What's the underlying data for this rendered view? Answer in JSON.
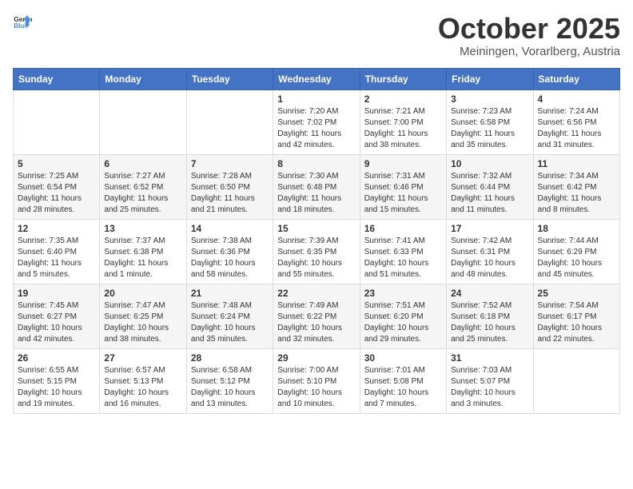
{
  "header": {
    "logo_general": "General",
    "logo_blue": "Blue",
    "title": "October 2025",
    "subtitle": "Meiningen, Vorarlberg, Austria"
  },
  "weekdays": [
    "Sunday",
    "Monday",
    "Tuesday",
    "Wednesday",
    "Thursday",
    "Friday",
    "Saturday"
  ],
  "weeks": [
    [
      {
        "day": "",
        "sunrise": "",
        "sunset": "",
        "daylight": ""
      },
      {
        "day": "",
        "sunrise": "",
        "sunset": "",
        "daylight": ""
      },
      {
        "day": "",
        "sunrise": "",
        "sunset": "",
        "daylight": ""
      },
      {
        "day": "1",
        "sunrise": "Sunrise: 7:20 AM",
        "sunset": "Sunset: 7:02 PM",
        "daylight": "Daylight: 11 hours and 42 minutes."
      },
      {
        "day": "2",
        "sunrise": "Sunrise: 7:21 AM",
        "sunset": "Sunset: 7:00 PM",
        "daylight": "Daylight: 11 hours and 38 minutes."
      },
      {
        "day": "3",
        "sunrise": "Sunrise: 7:23 AM",
        "sunset": "Sunset: 6:58 PM",
        "daylight": "Daylight: 11 hours and 35 minutes."
      },
      {
        "day": "4",
        "sunrise": "Sunrise: 7:24 AM",
        "sunset": "Sunset: 6:56 PM",
        "daylight": "Daylight: 11 hours and 31 minutes."
      }
    ],
    [
      {
        "day": "5",
        "sunrise": "Sunrise: 7:25 AM",
        "sunset": "Sunset: 6:54 PM",
        "daylight": "Daylight: 11 hours and 28 minutes."
      },
      {
        "day": "6",
        "sunrise": "Sunrise: 7:27 AM",
        "sunset": "Sunset: 6:52 PM",
        "daylight": "Daylight: 11 hours and 25 minutes."
      },
      {
        "day": "7",
        "sunrise": "Sunrise: 7:28 AM",
        "sunset": "Sunset: 6:50 PM",
        "daylight": "Daylight: 11 hours and 21 minutes."
      },
      {
        "day": "8",
        "sunrise": "Sunrise: 7:30 AM",
        "sunset": "Sunset: 6:48 PM",
        "daylight": "Daylight: 11 hours and 18 minutes."
      },
      {
        "day": "9",
        "sunrise": "Sunrise: 7:31 AM",
        "sunset": "Sunset: 6:46 PM",
        "daylight": "Daylight: 11 hours and 15 minutes."
      },
      {
        "day": "10",
        "sunrise": "Sunrise: 7:32 AM",
        "sunset": "Sunset: 6:44 PM",
        "daylight": "Daylight: 11 hours and 11 minutes."
      },
      {
        "day": "11",
        "sunrise": "Sunrise: 7:34 AM",
        "sunset": "Sunset: 6:42 PM",
        "daylight": "Daylight: 11 hours and 8 minutes."
      }
    ],
    [
      {
        "day": "12",
        "sunrise": "Sunrise: 7:35 AM",
        "sunset": "Sunset: 6:40 PM",
        "daylight": "Daylight: 11 hours and 5 minutes."
      },
      {
        "day": "13",
        "sunrise": "Sunrise: 7:37 AM",
        "sunset": "Sunset: 6:38 PM",
        "daylight": "Daylight: 11 hours and 1 minute."
      },
      {
        "day": "14",
        "sunrise": "Sunrise: 7:38 AM",
        "sunset": "Sunset: 6:36 PM",
        "daylight": "Daylight: 10 hours and 58 minutes."
      },
      {
        "day": "15",
        "sunrise": "Sunrise: 7:39 AM",
        "sunset": "Sunset: 6:35 PM",
        "daylight": "Daylight: 10 hours and 55 minutes."
      },
      {
        "day": "16",
        "sunrise": "Sunrise: 7:41 AM",
        "sunset": "Sunset: 6:33 PM",
        "daylight": "Daylight: 10 hours and 51 minutes."
      },
      {
        "day": "17",
        "sunrise": "Sunrise: 7:42 AM",
        "sunset": "Sunset: 6:31 PM",
        "daylight": "Daylight: 10 hours and 48 minutes."
      },
      {
        "day": "18",
        "sunrise": "Sunrise: 7:44 AM",
        "sunset": "Sunset: 6:29 PM",
        "daylight": "Daylight: 10 hours and 45 minutes."
      }
    ],
    [
      {
        "day": "19",
        "sunrise": "Sunrise: 7:45 AM",
        "sunset": "Sunset: 6:27 PM",
        "daylight": "Daylight: 10 hours and 42 minutes."
      },
      {
        "day": "20",
        "sunrise": "Sunrise: 7:47 AM",
        "sunset": "Sunset: 6:25 PM",
        "daylight": "Daylight: 10 hours and 38 minutes."
      },
      {
        "day": "21",
        "sunrise": "Sunrise: 7:48 AM",
        "sunset": "Sunset: 6:24 PM",
        "daylight": "Daylight: 10 hours and 35 minutes."
      },
      {
        "day": "22",
        "sunrise": "Sunrise: 7:49 AM",
        "sunset": "Sunset: 6:22 PM",
        "daylight": "Daylight: 10 hours and 32 minutes."
      },
      {
        "day": "23",
        "sunrise": "Sunrise: 7:51 AM",
        "sunset": "Sunset: 6:20 PM",
        "daylight": "Daylight: 10 hours and 29 minutes."
      },
      {
        "day": "24",
        "sunrise": "Sunrise: 7:52 AM",
        "sunset": "Sunset: 6:18 PM",
        "daylight": "Daylight: 10 hours and 25 minutes."
      },
      {
        "day": "25",
        "sunrise": "Sunrise: 7:54 AM",
        "sunset": "Sunset: 6:17 PM",
        "daylight": "Daylight: 10 hours and 22 minutes."
      }
    ],
    [
      {
        "day": "26",
        "sunrise": "Sunrise: 6:55 AM",
        "sunset": "Sunset: 5:15 PM",
        "daylight": "Daylight: 10 hours and 19 minutes."
      },
      {
        "day": "27",
        "sunrise": "Sunrise: 6:57 AM",
        "sunset": "Sunset: 5:13 PM",
        "daylight": "Daylight: 10 hours and 16 minutes."
      },
      {
        "day": "28",
        "sunrise": "Sunrise: 6:58 AM",
        "sunset": "Sunset: 5:12 PM",
        "daylight": "Daylight: 10 hours and 13 minutes."
      },
      {
        "day": "29",
        "sunrise": "Sunrise: 7:00 AM",
        "sunset": "Sunset: 5:10 PM",
        "daylight": "Daylight: 10 hours and 10 minutes."
      },
      {
        "day": "30",
        "sunrise": "Sunrise: 7:01 AM",
        "sunset": "Sunset: 5:08 PM",
        "daylight": "Daylight: 10 hours and 7 minutes."
      },
      {
        "day": "31",
        "sunrise": "Sunrise: 7:03 AM",
        "sunset": "Sunset: 5:07 PM",
        "daylight": "Daylight: 10 hours and 3 minutes."
      },
      {
        "day": "",
        "sunrise": "",
        "sunset": "",
        "daylight": ""
      }
    ]
  ]
}
